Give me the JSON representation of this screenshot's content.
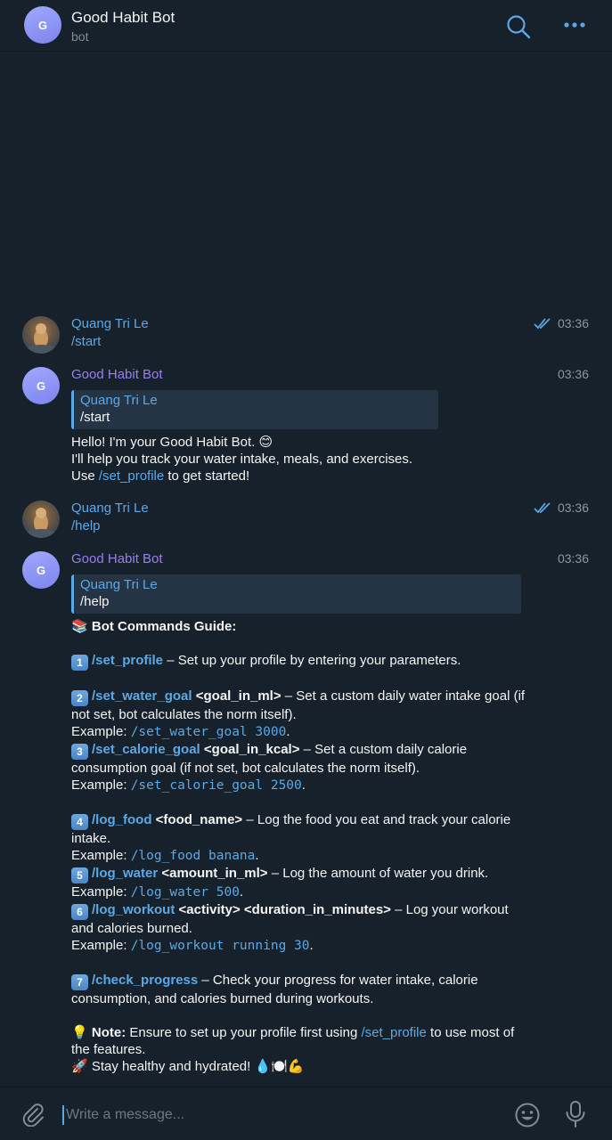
{
  "header": {
    "avatar_letter": "G",
    "title": "Good Habit Bot",
    "subtitle": "bot",
    "icons": [
      "search-icon",
      "more-icon"
    ]
  },
  "messages": [
    {
      "sender": "Quang Tri Le",
      "time": "03:36",
      "text": "/start",
      "read": true
    },
    {
      "sender": "Good Habit Bot",
      "avatar_letter": "G",
      "time": "03:36",
      "reply": {
        "name": "Quang Tri Le",
        "text": "/start"
      },
      "lines": {
        "l1": "Hello! I'm your Good Habit Bot. 😊",
        "l2": "I'll help you track your water intake, meals, and exercises.",
        "l3_pre": "Use ",
        "l3_link": "/set_profile",
        "l3_post": " to get started!"
      }
    },
    {
      "sender": "Quang Tri Le",
      "time": "03:36",
      "text": "/help",
      "read": true
    },
    {
      "sender": "Good Habit Bot",
      "avatar_letter": "G",
      "time": "03:36",
      "reply": {
        "name": "Quang Tri Le",
        "text": "/help"
      },
      "guide": {
        "heading_emoji": "📚",
        "heading": "Bot Commands Guide:",
        "commands": [
          {
            "num": "1",
            "cmd": "/set_profile",
            "args": "",
            "desc": " – Set up your profile by entering your parameters."
          },
          {
            "num": "2",
            "cmd": "/set_water_goal",
            "args": " <goal_in_ml>",
            "desc": " – Set a custom daily water intake goal (if not set, bot calculates the norm itself).",
            "example_label": "Example: ",
            "example": "/set_water_goal 3000"
          },
          {
            "num": "3",
            "cmd": "/set_calorie_goal",
            "args": " <goal_in_kcal>",
            "desc": " – Set a custom daily calorie consumption goal (if not set, bot calculates the norm itself).",
            "example_label": "Example: ",
            "example": "/set_calorie_goal 2500"
          },
          {
            "num": "4",
            "cmd": "/log_food",
            "args": " <food_name>",
            "desc": " – Log the food you eat and track your calorie intake.",
            "example_label": "Example: ",
            "example": "/log_food banana"
          },
          {
            "num": "5",
            "cmd": "/log_water",
            "args": " <amount_in_ml>",
            "desc": " – Log the amount of water you drink.",
            "example_label": "Example: ",
            "example": "/log_water 500"
          },
          {
            "num": "6",
            "cmd": "/log_workout",
            "args": " <activity> <duration_in_minutes>",
            "desc": " – Log your workout and calories burned.",
            "example_label": "Example: ",
            "example": "/log_workout running 30"
          },
          {
            "num": "7",
            "cmd": "/check_progress",
            "args": "",
            "desc": " – Check your progress for water intake, calorie consumption, and calories burned during workouts."
          }
        ],
        "note_emoji": "💡",
        "note_label": "Note:",
        "note_pre": " Ensure to set up your profile first using ",
        "note_link": "/set_profile",
        "note_post": " to use most of the features.",
        "closing": "🚀 Stay healthy and hydrated! 💧🍽️💪"
      }
    }
  ],
  "composer": {
    "placeholder": "Write a message...",
    "icons": [
      "attach-icon",
      "emoji-icon",
      "mic-icon"
    ]
  }
}
